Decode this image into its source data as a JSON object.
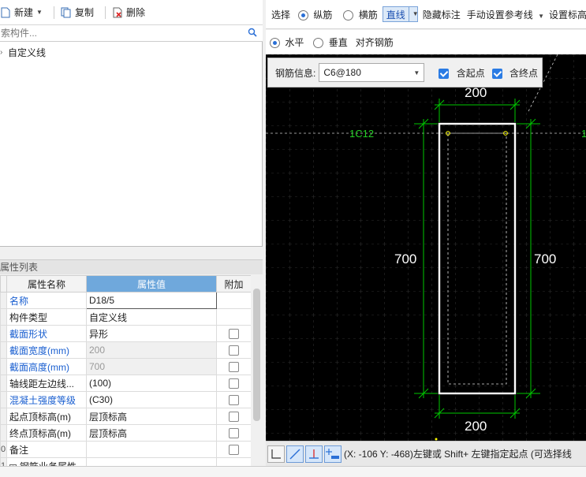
{
  "toolbar": {
    "new_label": "新建",
    "copy_label": "复制",
    "delete_label": "删除"
  },
  "search": {
    "placeholder": "索构件..."
  },
  "tree": {
    "items": [
      {
        "label": "自定义线"
      }
    ]
  },
  "properties": {
    "header": "属性列表",
    "columns": [
      "属性名称",
      "属性值",
      "附加"
    ],
    "rows": [
      {
        "num": "",
        "name": "名称",
        "value": "D18/5",
        "blue": true,
        "grey": false,
        "checkbox": false
      },
      {
        "num": "",
        "name": "构件类型",
        "value": "自定义线",
        "blue": false,
        "grey": false,
        "checkbox": false
      },
      {
        "num": "",
        "name": "截面形状",
        "value": "异形",
        "blue": true,
        "grey": false,
        "checkbox": true
      },
      {
        "num": "",
        "name": "截面宽度(mm)",
        "value": "200",
        "blue": true,
        "grey": true,
        "checkbox": true
      },
      {
        "num": "",
        "name": "截面高度(mm)",
        "value": "700",
        "blue": true,
        "grey": true,
        "checkbox": true
      },
      {
        "num": "",
        "name": "轴线距左边线...",
        "value": "(100)",
        "blue": false,
        "grey": false,
        "checkbox": true
      },
      {
        "num": "",
        "name": "混凝土强度等级",
        "value": "(C30)",
        "blue": true,
        "grey": false,
        "checkbox": true
      },
      {
        "num": "",
        "name": "起点顶标高(m)",
        "value": "层顶标高",
        "blue": false,
        "grey": false,
        "checkbox": true
      },
      {
        "num": "",
        "name": "终点顶标高(m)",
        "value": "层顶标高",
        "blue": false,
        "grey": false,
        "checkbox": true
      },
      {
        "num": "0",
        "name": "备注",
        "value": "",
        "blue": false,
        "grey": false,
        "checkbox": true
      },
      {
        "num": "1",
        "name": "钢筋业务属性",
        "value": "",
        "blue": false,
        "grey": false,
        "checkbox": false,
        "expand": "+"
      }
    ]
  },
  "draw_toolbar": {
    "select_label": "选择",
    "longitudinal_label": "纵筋",
    "transverse_label": "横筋",
    "line_mode_label": "直线",
    "hide_label_label": "隐藏标注",
    "manual_ref_label": "手动设置参考线",
    "set_mark_label": "设置标高"
  },
  "draw_toolbar2": {
    "horizontal_label": "水平",
    "vertical_label": "垂直",
    "align_label": "对齐钢筋"
  },
  "rebar_info": {
    "label": "钢筋信息:",
    "value": "C6@180",
    "start_point_label": "含起点",
    "end_point_label": "含终点"
  },
  "canvas": {
    "rebar_label_left": "1C12",
    "rebar_label_right": "1",
    "dim_top": "200",
    "dim_bottom": "200",
    "dim_left": "700",
    "dim_right": "700"
  },
  "status": {
    "coords_text": "(X: -106 Y: -468)左键或 Shift+ 左键指定起点 (可选择线"
  },
  "colors": {
    "header_highlight": "#6fa8dc",
    "blue_text": "#1a5fd0",
    "dim_green": "#00c800",
    "label_green": "#22cc22",
    "canvas_bg": "#000000"
  }
}
